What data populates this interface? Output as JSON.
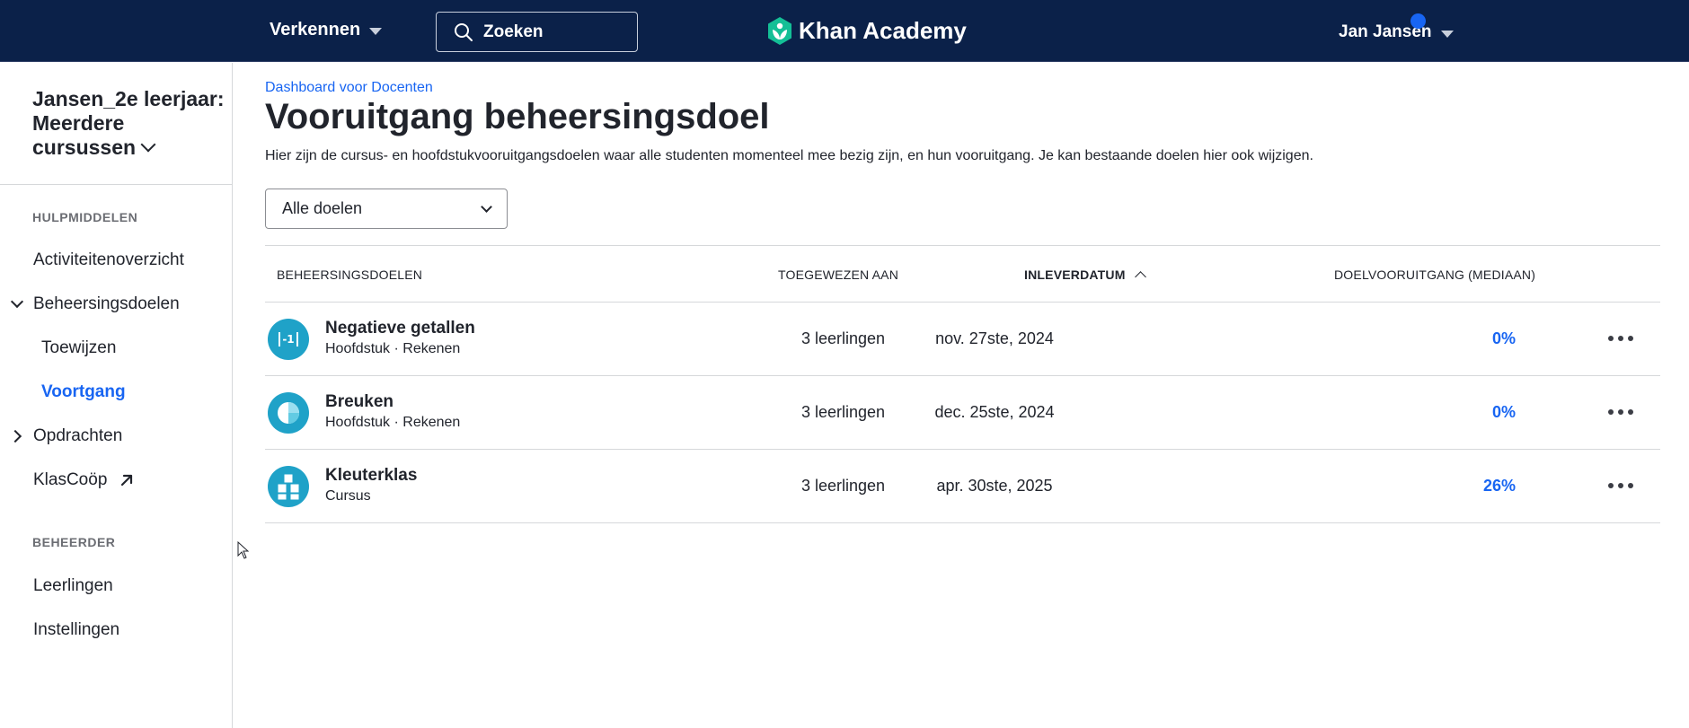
{
  "topbar": {
    "explore_label": "Verkennen",
    "search_label": "Zoeken",
    "logo_text": "Khan Academy",
    "user_name": "Jan Jansen"
  },
  "sidebar": {
    "class_title": "Jansen_2e leerjaar: Meerdere cursussen",
    "section_tools": "HULPMIDDELEN",
    "items": {
      "activity": "Activiteitenoverzicht",
      "mastery_goals": "Beheersingsdoelen",
      "assign": "Toewijzen",
      "progress": "Voortgang",
      "assignments": "Opdrachten",
      "klascoop": "KlasCoöp"
    },
    "section_admin": "BEHEERDER",
    "admin_items": {
      "students": "Leerlingen",
      "settings": "Instellingen"
    }
  },
  "main": {
    "breadcrumb": "Dashboard voor Docenten",
    "title": "Vooruitgang beheersingsdoel",
    "description": "Hier zijn de cursus- en hoofdstukvooruitgangsdoelen waar alle studenten momenteel mee bezig zijn, en hun vooruitgang. Je kan bestaande doelen hier ook wijzigen.",
    "filter_value": "Alle doelen"
  },
  "table": {
    "headers": {
      "goals": "BEHEERSINGSDOELEN",
      "assigned": "TOEGEWEZEN AAN",
      "due": "INLEVERDATUM",
      "progress": "DOELVOORUITGANG (MEDIAAN)"
    },
    "rows": [
      {
        "title": "Negatieve getallen",
        "subtitle": "Hoofdstuk · Rekenen",
        "assigned": "3 leerlingen",
        "due": "nov. 27ste, 2024",
        "progress": "0%",
        "icon": "negative-numbers-icon"
      },
      {
        "title": "Breuken",
        "subtitle": "Hoofdstuk · Rekenen",
        "assigned": "3 leerlingen",
        "due": "dec. 25ste, 2024",
        "progress": "0%",
        "icon": "fractions-icon"
      },
      {
        "title": "Kleuterklas",
        "subtitle": "Cursus",
        "assigned": "3 leerlingen",
        "due": "apr. 30ste, 2025",
        "progress": "26%",
        "icon": "kindergarten-cubes-icon"
      }
    ]
  },
  "colors": {
    "topbar_bg": "#0b2149",
    "accent_blue": "#1865f2",
    "icon_teal": "#1fa2c8",
    "logo_green": "#14bf96"
  }
}
